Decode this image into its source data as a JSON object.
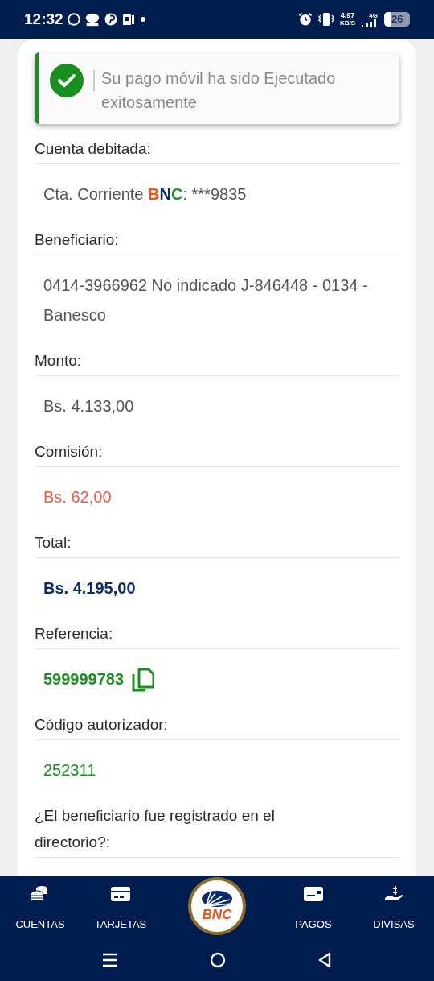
{
  "status_bar": {
    "time": "12:32",
    "net_speed": "4,97",
    "net_unit": "KB/S",
    "network": "4G",
    "battery": "26"
  },
  "banner": {
    "message": "Su pago móvil ha sido Ejecutado exitosamente"
  },
  "fields": [
    {
      "label": "Cuenta debitada:",
      "kind": "account",
      "value_parts": [
        {
          "text": "Cta. Corriente "
        },
        {
          "text": "B",
          "color": "#e8541c"
        },
        {
          "text": "N",
          "color": "#0b2a6b"
        },
        {
          "text": "C",
          "color": "#1f8f2a"
        },
        {
          "text": ": ***9835"
        }
      ]
    },
    {
      "label": "Beneficiario:",
      "kind": "plain",
      "value": "0414-3966962 No indicado J-846448 - 0134 - Banesco"
    },
    {
      "label": "Monto:",
      "kind": "plain",
      "value": "Bs. 4.133,00"
    },
    {
      "label": "Comisión:",
      "kind": "fee",
      "value": "Bs. 62,00"
    },
    {
      "label": "Total:",
      "kind": "total",
      "value": "Bs. 4.195,00"
    },
    {
      "label": "Referencia:",
      "kind": "reference",
      "value": "599999783"
    },
    {
      "label": "Código autorizador:",
      "kind": "code",
      "value": "252311"
    },
    {
      "label": "¿El beneficiario fue registrado en el directorio?:",
      "kind": "label_only"
    }
  ],
  "bottom_nav": [
    {
      "label": "CUENTAS",
      "kind": "coins"
    },
    {
      "label": "TARJETAS",
      "kind": "card"
    },
    {
      "label": "BNC",
      "kind": "logo"
    },
    {
      "label": "PAGOS",
      "kind": "payment"
    },
    {
      "label": "DIVISAS",
      "kind": "currency"
    }
  ]
}
